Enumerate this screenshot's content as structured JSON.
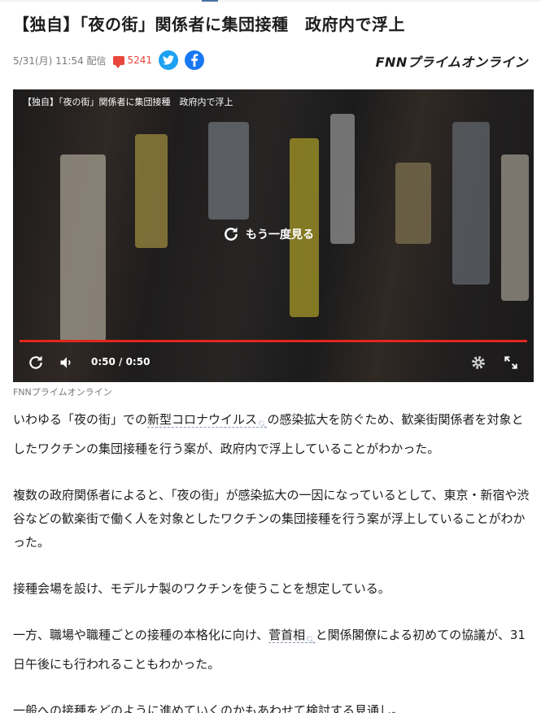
{
  "headline": "【独自】「夜の街」関係者に集団接種　政府内で浮上",
  "meta": {
    "date": "5/31(月) 11:54 配信",
    "comment_count": "5241",
    "twitter_icon": "twitter-icon",
    "facebook_icon": "facebook-icon"
  },
  "brand": "FNNプライムオンライン",
  "video": {
    "title": "【独自】「夜の街」関係者に集団接種　政府内で浮上",
    "replay_label": "もう一度見る",
    "timecode": "0:50 / 0:50",
    "progress": 1.0
  },
  "caption": "FNNプライムオンライン",
  "article": {
    "p1": {
      "before": "いわゆる「夜の街」での",
      "keyword": "新型コロナウイルス",
      "after": "の感染拡大を防ぐため、歓楽街関係者を対象としたワクチンの集団接種を行う案が、政府内で浮上していることがわかった。"
    },
    "p2": "複数の政府関係者によると、「夜の街」が感染拡大の一因になっているとして、東京・新宿や渋谷などの歓楽街で働く人を対象としたワクチンの集団接種を行う案が浮上していることがわかった。",
    "p3": "接種会場を設け、モデルナ製のワクチンを使うことを想定している。",
    "p4": {
      "before": "一方、職場や職種ごとの接種の本格化に向け、",
      "keyword": "菅首相",
      "after": "と関係閣僚による初めての協議が、31日午後にも行われることもわかった。"
    },
    "p5": "一般への接種をどのように進めていくのかもあわせて検討する見通し。"
  },
  "colors": {
    "accent_red": "#e0271d",
    "comment_red": "#e8463a",
    "twitter_blue": "#1da1f2",
    "facebook_blue": "#1877f2"
  }
}
